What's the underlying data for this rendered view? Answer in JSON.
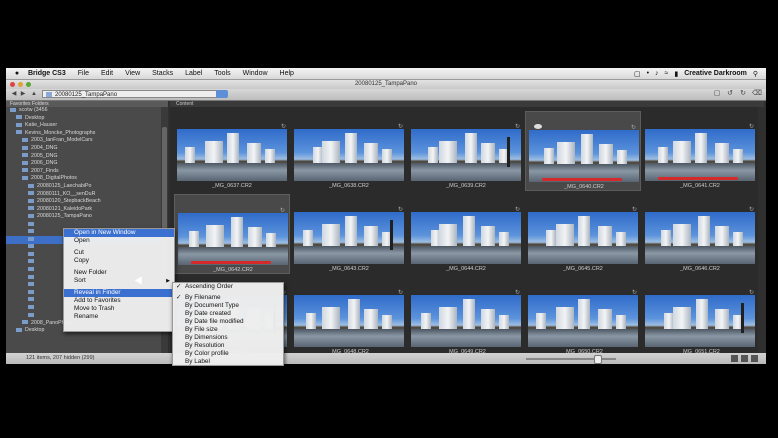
{
  "menubar": {
    "app_name": "Bridge CS3",
    "items": [
      "File",
      "Edit",
      "View",
      "Stacks",
      "Label",
      "Tools",
      "Window",
      "Help"
    ],
    "user": "Creative Darkroom"
  },
  "window": {
    "title": "20080125_TampaPano"
  },
  "pathbar": {
    "path": "20080125_TampaPano"
  },
  "folders": {
    "tab_label": "Favorites Folders",
    "items": [
      {
        "label": "scotw (3456"
      },
      {
        "label": "Desktop"
      },
      {
        "label": "Katie_Hauser"
      },
      {
        "label": "Kevins_Moncke_Photographs"
      },
      {
        "label": "2003_IanFran_ModelCars"
      },
      {
        "label": "2004_DNG"
      },
      {
        "label": "2005_DNG"
      },
      {
        "label": "2006_DNG"
      },
      {
        "label": "2007_Finds"
      },
      {
        "label": "2008_DigitalPhotos"
      },
      {
        "label": "20080125_LaechabiPo"
      },
      {
        "label": "20080111_KO__senDuR"
      },
      {
        "label": "20080120_StepbackBeach"
      },
      {
        "label": "20080121_KaleidoPark"
      },
      {
        "label": "20080125_TampaPano"
      },
      {
        "label": ""
      },
      {
        "label": ""
      },
      {
        "label": ""
      },
      {
        "label": ""
      },
      {
        "label": ""
      },
      {
        "label": ""
      },
      {
        "label": ""
      },
      {
        "label": ""
      },
      {
        "label": ""
      },
      {
        "label": ""
      },
      {
        "label": ""
      },
      {
        "label": ""
      },
      {
        "label": ""
      },
      {
        "label": "2008_PanoPhase"
      },
      {
        "label": "Desktop"
      }
    ]
  },
  "content": {
    "tab_label": "Content",
    "thumbnails": [
      {
        "label": "_MG_0637.CR2",
        "selected": false,
        "red_label": false
      },
      {
        "label": "_MG_0638.CR2",
        "selected": false,
        "red_label": false
      },
      {
        "label": "_MG_0639.CR2",
        "selected": false,
        "red_label": false
      },
      {
        "label": "_MG_0640.CR2",
        "selected": true,
        "red_label": true
      },
      {
        "label": "_MG_0641.CR2",
        "selected": false,
        "red_label": true
      },
      {
        "label": "_MG_0642.CR2",
        "selected": true,
        "red_label": true
      },
      {
        "label": "_MG_0643.CR2",
        "selected": false,
        "red_label": false
      },
      {
        "label": "_MG_0644.CR2",
        "selected": false,
        "red_label": false
      },
      {
        "label": "_MG_0645.CR2",
        "selected": false,
        "red_label": false
      },
      {
        "label": "_MG_0646.CR2",
        "selected": false,
        "red_label": false
      },
      {
        "label": "_MG_0647.CR2",
        "selected": false,
        "red_label": false
      },
      {
        "label": "_MG_0648.CR2",
        "selected": false,
        "red_label": false
      },
      {
        "label": "_MG_0649.CR2",
        "selected": false,
        "red_label": false
      },
      {
        "label": "_MG_0650.CR2",
        "selected": false,
        "red_label": false
      },
      {
        "label": "_MG_0651.CR2",
        "selected": false,
        "red_label": false
      }
    ]
  },
  "context_menu": {
    "items": [
      "Open in New Window",
      "Open",
      "Cut",
      "Copy",
      "New Folder",
      "Sort",
      "Reveal in Finder",
      "Add to Favorites",
      "Move to Trash",
      "Rename"
    ]
  },
  "sort_submenu": {
    "items": [
      "Ascending Order",
      "By Filename",
      "By Document Type",
      "By Date created",
      "By Date file modified",
      "By File size",
      "By Dimensions",
      "By Resolution",
      "By Color profile",
      "By Label"
    ]
  },
  "statusbar": {
    "text": "121 items, 207 hidden (299)"
  },
  "colors": {
    "accent": "#3b6fd0",
    "label_red": "#d42a2a"
  }
}
